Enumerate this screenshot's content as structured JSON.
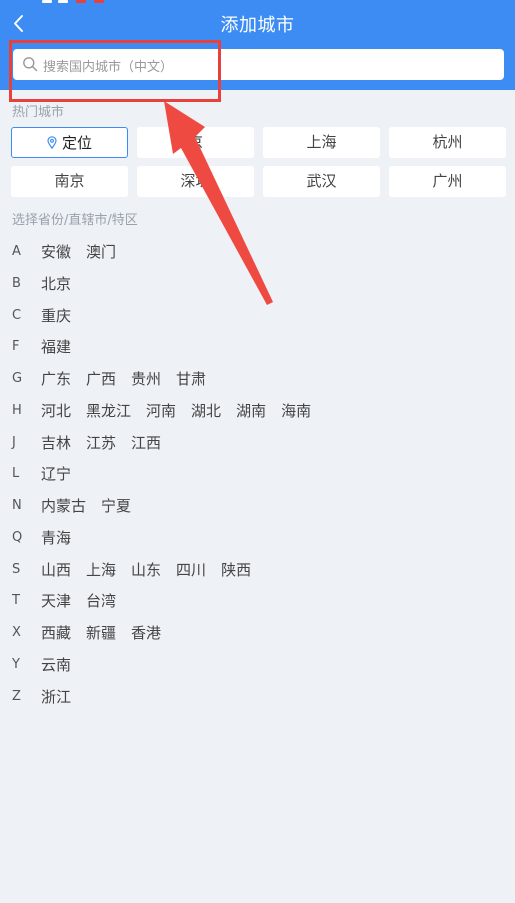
{
  "header": {
    "title": "添加城市",
    "back_icon": "chevron-left-icon",
    "background": "#3c8cf3"
  },
  "search": {
    "placeholder": "搜索国内城市（中文）",
    "icon": "search-icon"
  },
  "annotation": {
    "color": "#e8403a"
  },
  "hot_cities": {
    "label": "热门城市",
    "items": [
      {
        "label": "定位",
        "icon": "location-pin-icon"
      },
      {
        "label": "京"
      },
      {
        "label": "上海"
      },
      {
        "label": "杭州"
      },
      {
        "label": "南京"
      },
      {
        "label": "深圳"
      },
      {
        "label": "武汉"
      },
      {
        "label": "广州"
      }
    ]
  },
  "provinces": {
    "label": "选择省份/直辖市/特区",
    "groups": [
      {
        "letter": "A",
        "items": [
          "安徽",
          "澳门"
        ]
      },
      {
        "letter": "B",
        "items": [
          "北京"
        ]
      },
      {
        "letter": "C",
        "items": [
          "重庆"
        ]
      },
      {
        "letter": "F",
        "items": [
          "福建"
        ]
      },
      {
        "letter": "G",
        "items": [
          "广东",
          "广西",
          "贵州",
          "甘肃"
        ]
      },
      {
        "letter": "H",
        "items": [
          "河北",
          "黑龙江",
          "河南",
          "湖北",
          "湖南",
          "海南"
        ]
      },
      {
        "letter": "J",
        "items": [
          "吉林",
          "江苏",
          "江西"
        ]
      },
      {
        "letter": "L",
        "items": [
          "辽宁"
        ]
      },
      {
        "letter": "N",
        "items": [
          "内蒙古",
          "宁夏"
        ]
      },
      {
        "letter": "Q",
        "items": [
          "青海"
        ]
      },
      {
        "letter": "S",
        "items": [
          "山西",
          "上海",
          "山东",
          "四川",
          "陕西"
        ]
      },
      {
        "letter": "T",
        "items": [
          "天津",
          "台湾"
        ]
      },
      {
        "letter": "X",
        "items": [
          "西藏",
          "新疆",
          "香港"
        ]
      },
      {
        "letter": "Y",
        "items": [
          "云南"
        ]
      },
      {
        "letter": "Z",
        "items": [
          "浙江"
        ]
      }
    ]
  }
}
